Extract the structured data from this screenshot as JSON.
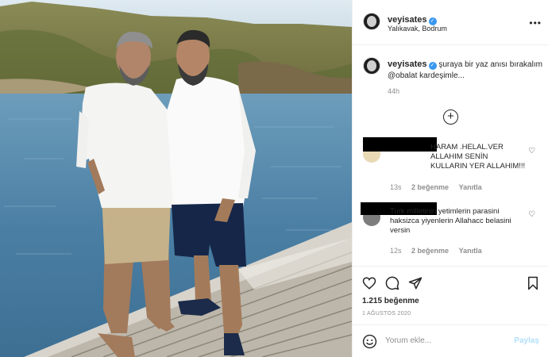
{
  "post": {
    "username": "veyisates",
    "location": "Yalıkavak, Bodrum",
    "more_icon": "more-dots-icon",
    "caption_text": "şuraya bir yaz anısı bırakalım @obalat kardeşimle...",
    "caption_time": "44h",
    "load_more_icon": "plus-circle-icon"
  },
  "comments": [
    {
      "text": "HARAM .HELAL.VER ALLAHIM SENİN KULLARIN YER ALLAHIM!!!",
      "time": "13s",
      "likes": "2 beğenme",
      "reply": "Yanıtla"
    },
    {
      "text": "Turk milletinin yetimlerin parasini haksizca yiyenlerin Allahacc belasini versin",
      "time": "12s",
      "likes": "2 beğenme",
      "reply": "Yanıtla"
    }
  ],
  "actions": {
    "icons": [
      "heart-icon",
      "comment-icon",
      "share-icon",
      "bookmark-icon"
    ],
    "likes_count": "1.215 beğenme",
    "date": "1 AĞUSTOS 2020"
  },
  "add_comment": {
    "placeholder": "Yorum ekle...",
    "post_label": "Paylaş"
  },
  "colors": {
    "verified": "#3897f0",
    "post_button_disabled": "#b2dffc",
    "meta_gray": "#8e8e8e"
  }
}
